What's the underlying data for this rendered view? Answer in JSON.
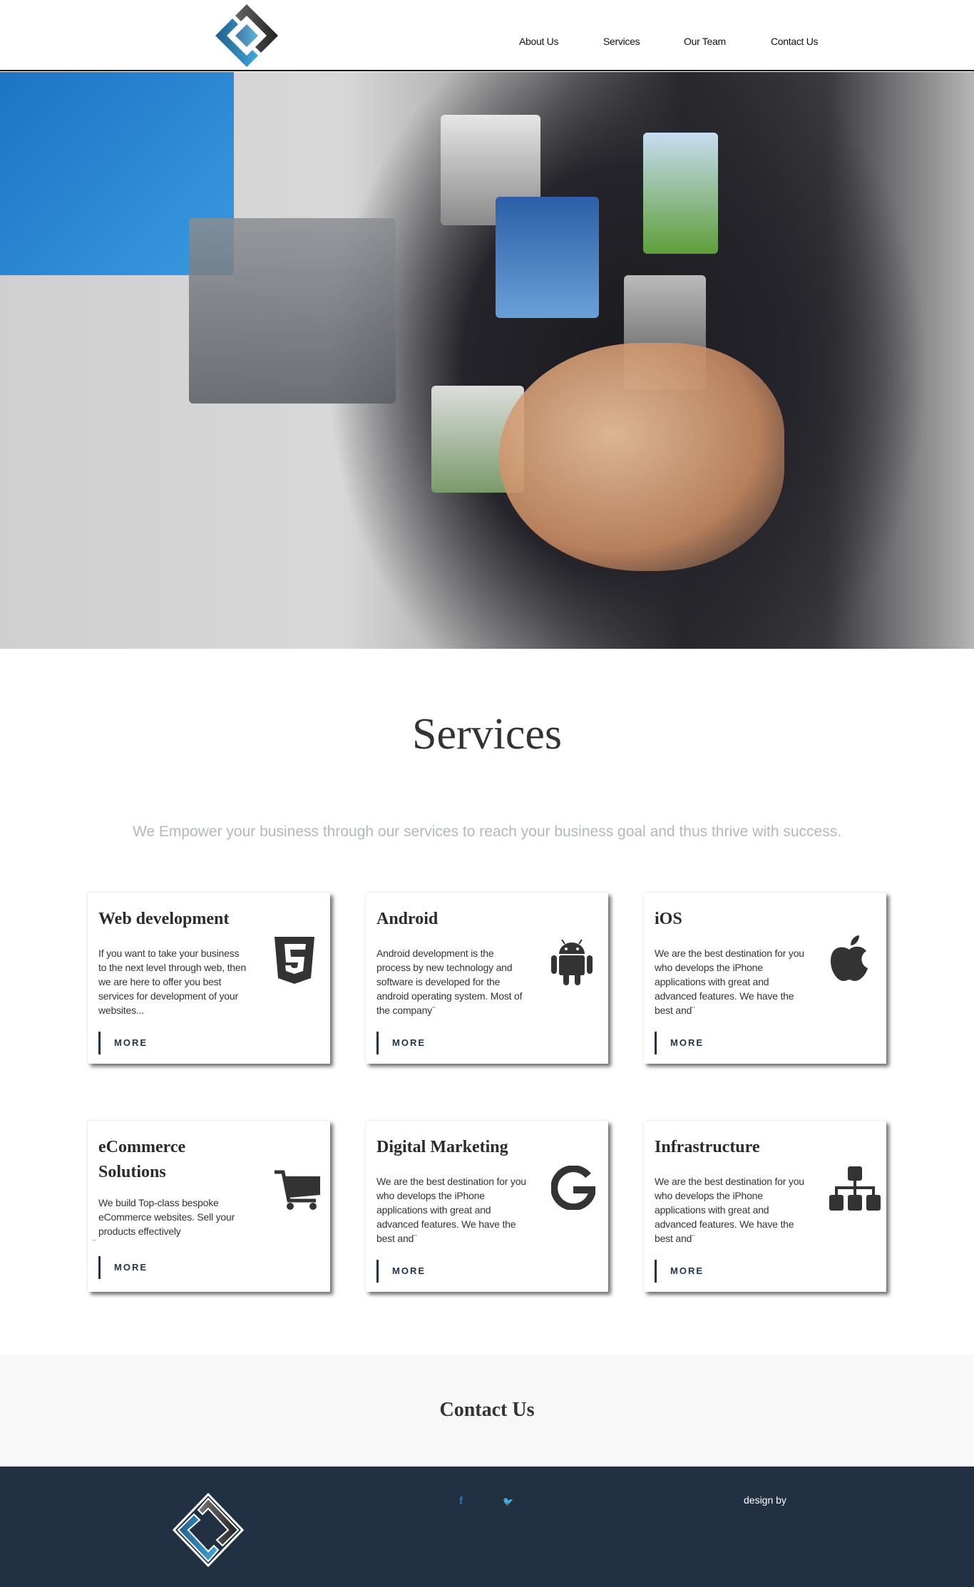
{
  "header": {
    "nav": [
      {
        "label": "About Us"
      },
      {
        "label": "Services"
      },
      {
        "label": "Our Team"
      },
      {
        "label": "Contact Us"
      }
    ]
  },
  "services": {
    "title": "Services",
    "subtitle": "We Empower your business through our services to reach your business goal and thus thrive with success.",
    "more_label": "MORE",
    "cards": [
      {
        "title": "Web development",
        "text": "If you want to take your business to the next level through web, then we are here to offer you best services for development of your websites...",
        "icon": "html5-icon"
      },
      {
        "title": "Android",
        "text": "Android development is the process by new technology and software is developed for the android operating system. Most of the company¨",
        "icon": "android-icon"
      },
      {
        "title": "iOS",
        "text": "We are the best destination for you who develops the iPhone applications with great and advanced features. We have the best and¨",
        "icon": "apple-icon"
      },
      {
        "title": "eCommerce Solutions",
        "text": "We build Top-class bespoke eCommerce websites. Sell your products effectively",
        "extra": "..",
        "icon": "shopping-cart-icon"
      },
      {
        "title": "Digital Marketing",
        "text": "We are the best destination for you who develops the iPhone applications with great and advanced features. We have the best and¨",
        "icon": "google-icon"
      },
      {
        "title": "Infrastructure",
        "text": "We are the best destination for you who develops the iPhone applications with great and advanced features. We have the best and¨",
        "icon": "sitemap-icon"
      }
    ]
  },
  "contact": {
    "title": "Contact Us"
  },
  "footer": {
    "facebook": "f",
    "twitter": "🐦",
    "design_by": "design by"
  },
  "colors": {
    "footer_bg": "#213043",
    "accent": "#2f76b6",
    "card_border": "#243447"
  }
}
